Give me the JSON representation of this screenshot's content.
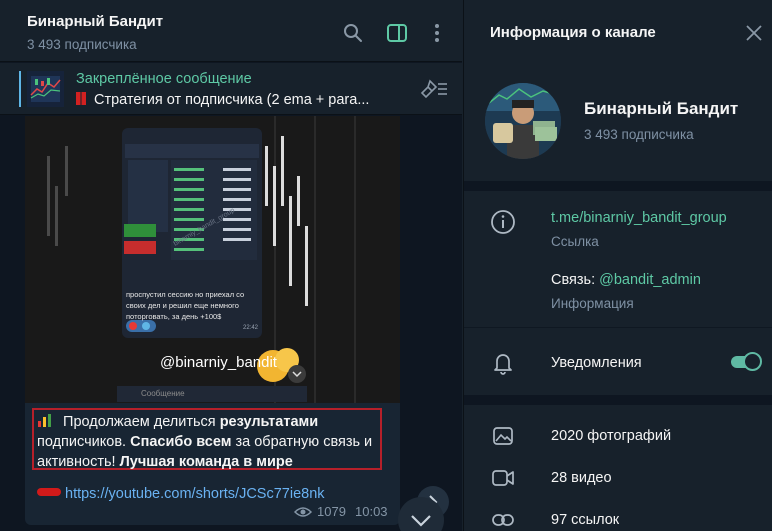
{
  "chat": {
    "title": "Бинарный Бандит",
    "subscribers": "3 493 подписчика",
    "pinned": {
      "label": "Закреплённое сообщение",
      "text": "Стратегия от подписчика (2 ema + para..."
    },
    "message": {
      "photo_caption": "проспустил сессию но приехал со своих дел и решил еще немного поторговать, за день +100$",
      "photo_time": "22:42",
      "photo_watermark": "@binarniy_bandit",
      "photo_input_placeholder": "Сообщение",
      "text_part1": " Продолжаем делиться ",
      "text_bold1": "результатами",
      "text_part2": " подписчиков. ",
      "text_bold2": "Спасибо всем",
      "text_part3": " за обратную связь и активность! ",
      "text_bold3": "Лучшая команда в мире",
      "link": "https://youtube.com/shorts/JCSc77ie8nk",
      "views": "1079",
      "time": "10:03"
    }
  },
  "info": {
    "title": "Информация о канале",
    "name": "Бинарный Бандит",
    "subscribers": "3 493 подписчика",
    "link_value": "t.me/binarniy_bandit_group",
    "link_label": "Ссылка",
    "contact_prefix": "Связь: ",
    "contact_handle": "@bandit_admin",
    "contact_label": "Информация",
    "notifications_label": "Уведомления",
    "notifications_on": true,
    "photos": "2020 фотографий",
    "videos": "28 видео",
    "links": "97 ссылок"
  },
  "colors": {
    "accent_green": "#5ec9a5",
    "link_blue": "#6ab2f2",
    "highlight_red": "#b6202a"
  }
}
